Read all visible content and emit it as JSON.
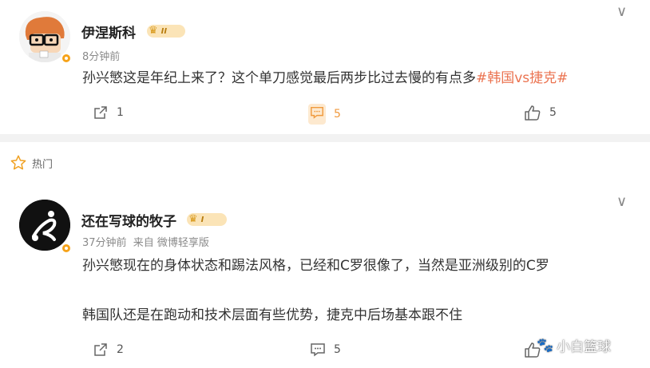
{
  "comments": [
    {
      "username": "伊涅斯科",
      "level": "II",
      "time": "8分钟前",
      "source": "",
      "text_plain": "孙兴慜这是年纪上来了？这个单刀感觉最后两步比过去慢的有点多",
      "hashtag": "#韩国vs捷克#",
      "actions": {
        "share": "1",
        "comment": "5",
        "like": "5"
      }
    },
    {
      "username": "还在写球的牧子",
      "level": "I",
      "time": "37分钟前",
      "source": "来自 微博轻享版",
      "line1": "孙兴慜现在的身体状态和踢法风格，已经和C罗很像了，当然是亚洲级别的C罗",
      "line2": "韩国队还是在跑动和技术层面有些优势，捷克中后场基本跟不住",
      "actions": {
        "share": "2",
        "comment": "5"
      }
    }
  ],
  "section": {
    "hot_label": "热门"
  },
  "watermark": "小白篮球",
  "colors": {
    "accent": "#eb7350",
    "comment_highlight": "#f09a3e",
    "divider": "#f2f2f2"
  },
  "icons": [
    "more-icon",
    "share-icon",
    "comment-icon",
    "like-icon",
    "star-icon",
    "crown-icon",
    "verified-badge-icon"
  ]
}
